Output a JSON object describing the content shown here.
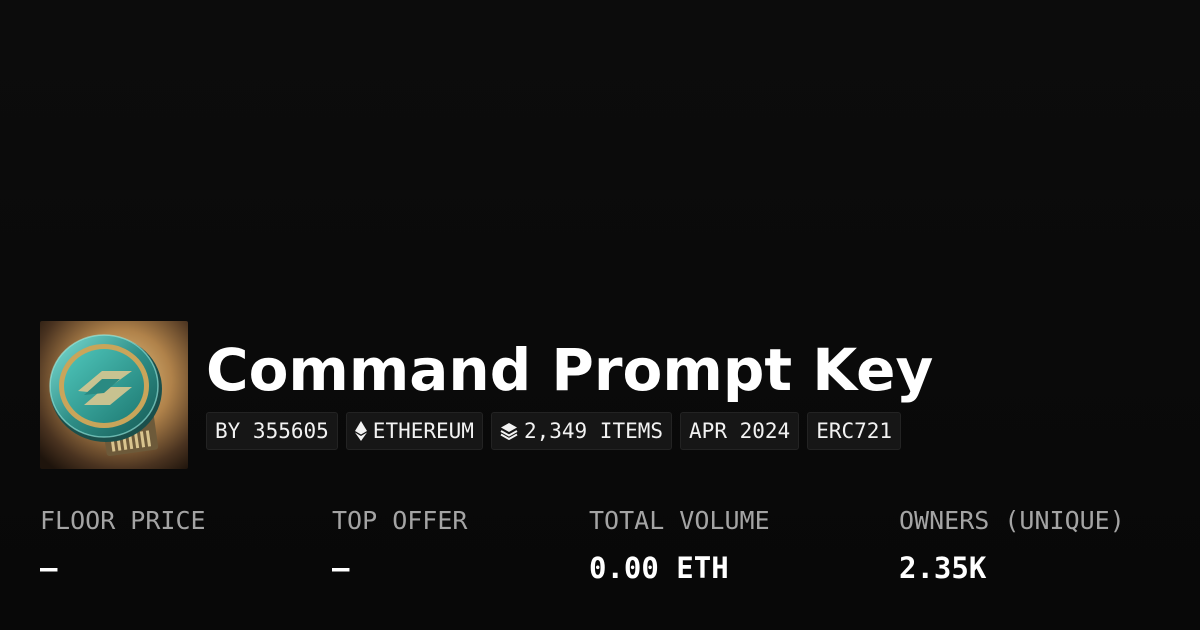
{
  "collection": {
    "title": "Command Prompt Key",
    "thumbnail_icon": "command-prompt-key-coin-icon"
  },
  "badges": [
    {
      "label": "BY 355605",
      "icon": null
    },
    {
      "label": "ETHEREUM",
      "icon": "ethereum-icon"
    },
    {
      "label": "2,349 ITEMS",
      "icon": "layers-icon"
    },
    {
      "label": "APR 2024",
      "icon": null
    },
    {
      "label": "ERC721",
      "icon": null
    }
  ],
  "stats": [
    {
      "label": "FLOOR PRICE",
      "value": "—"
    },
    {
      "label": "TOP OFFER",
      "value": "—"
    },
    {
      "label": "TOTAL VOLUME",
      "value": "0.00 ETH"
    },
    {
      "label": "OWNERS (UNIQUE)",
      "value": "2.35K"
    }
  ],
  "colors": {
    "background": "#0b0b0b",
    "badge_background": "#161616",
    "label_gray": "#a4a4a4",
    "text": "#ffffff",
    "coin_teal": "#3aa8a0",
    "coin_gold": "#c9a55a"
  }
}
